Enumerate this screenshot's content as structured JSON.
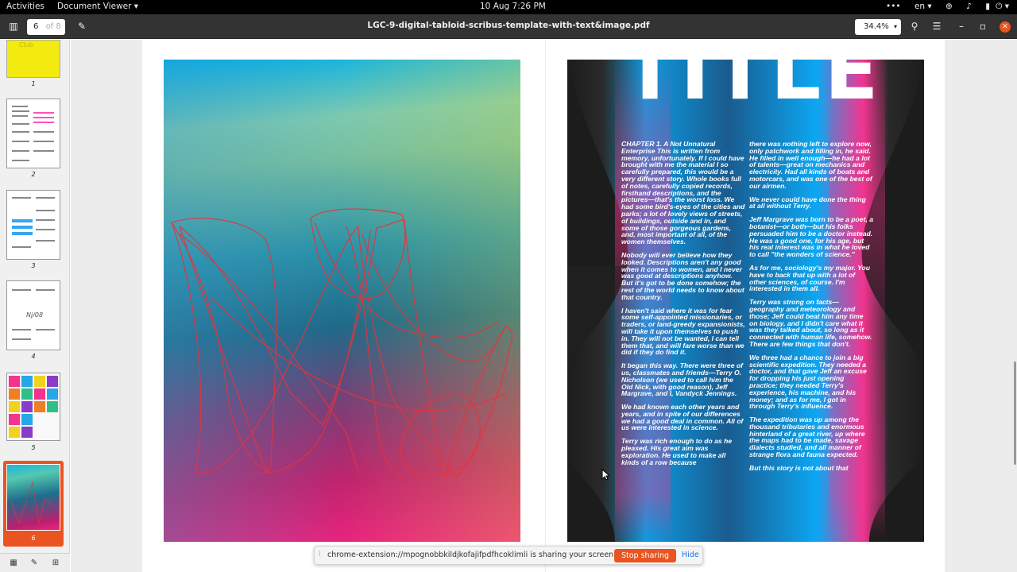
{
  "topbar": {
    "activities": "Activities",
    "app_menu": "Document Viewer ▾",
    "clock": "10 Aug  7:26 PM",
    "tray": {
      "dots": "•••",
      "lang": "en ▾",
      "net": "⊕",
      "volume": "♪",
      "battery": "▮",
      "power": "⏻ ▾"
    }
  },
  "header": {
    "sidebar_icon": "▥",
    "page_current": "6",
    "page_total": "of 8",
    "annotate_icon": "✎",
    "title": "LGC-9-digital-tabloid-scribus-template-with-text&image.pdf",
    "zoom": "34.4%",
    "zoom_caret": "▾",
    "search_icon": "⚲",
    "menu_icon": "☰",
    "minimize_icon": "–",
    "maximize_icon": "▫",
    "close_icon": "✕"
  },
  "sidebar": {
    "thumbs": [
      {
        "label": "1",
        "text": "Club"
      },
      {
        "label": "2"
      },
      {
        "label": "3"
      },
      {
        "label": "4",
        "text": "Nj/08"
      },
      {
        "label": "5"
      },
      {
        "label": "6"
      }
    ],
    "footer": {
      "thumbs_icon": "▦",
      "annot_icon": "✎",
      "bookmark_icon": "⊞"
    }
  },
  "document": {
    "title_word": "TITLE",
    "col_left": [
      "CHAPTER 1. A Not Unnatural Enterprise This is written from memory, unfortunately. If I could have brought with me the material I so carefully prepared, this would be a very different story. Whole books full of notes, carefully copied records, firsthand descriptions, and the pictures—that's the worst loss. We had some bird's-eyes of the cities and parks; a lot of lovely views of streets, of buildings, outside and in, and some of those gorgeous gardens, and, most important of all, of the women themselves.",
      "Nobody will ever believe how they looked. Descriptions aren't any good when it comes to women, and I never was good at descriptions anyhow. But it's got to be done somehow; the rest of the world needs to know about that country.",
      "I haven't said where it was for fear some self-appointed missionaries, or traders, or land-greedy expansionists, will take it upon themselves to push in. They will not be wanted, I can tell them that, and will fare worse than we did if they do find it.",
      "It began this way. There were three of us, classmates and friends—Terry O. Nicholson (we used to call him the Old Nick, with good reason), Jeff Margrave, and I, Vandyck Jennings.",
      "We had known each other years and years, and in spite of our differences we had a good deal in common. All of us were interested in science.",
      "Terry was rich enough to do as he pleased. His great aim was exploration. He used to make all kinds of a row because"
    ],
    "col_right": [
      "there was nothing left to explore now, only patchwork and filling in, he said. He filled in well enough—he had a lot of talents—great on mechanics and electricity. Had all kinds of boats and motorcars, and was one of the best of our airmen.",
      "We never could have done the thing at all without Terry.",
      "Jeff Margrave was born to be a poet, a botanist—or both—but his folks persuaded him to be a doctor instead. He was a good one, for his age, but his real interest was in what he loved to call \"the wonders of science.\"",
      "As for me, sociology's my major. You have to back that up with a lot of other sciences, of course. I'm interested in them all.",
      "Terry was strong on facts—geography and meteorology and those; Jeff could beat him any time on biology, and I didn't care what it was they talked about, so long as it connected with human life, somehow. There are few things that don't.",
      "We three had a chance to join a big scientific expedition. They needed a doctor, and that gave Jeff an excuse for dropping his just opening practice; they needed Terry's experience, his machine, and his money; and as for me, I got in through Terry's influence.",
      "The expedition was up among the thousand tributaries and enormous hinterland of a great river, up where the maps had to be made, savage dialects studied, and all manner of strange flora and fauna expected.",
      "But this story is not about that"
    ]
  },
  "sharebar": {
    "grip": "⁞",
    "message": "chrome-extension://mpognobbkildjkofajifpdfhcoklimli is sharing your screen.",
    "stop": "Stop sharing",
    "hide": "Hide"
  },
  "colors": {
    "accent": "#e95420",
    "header_bg": "#333333",
    "topbar_bg": "#000000",
    "scribble": "#e8323a"
  }
}
